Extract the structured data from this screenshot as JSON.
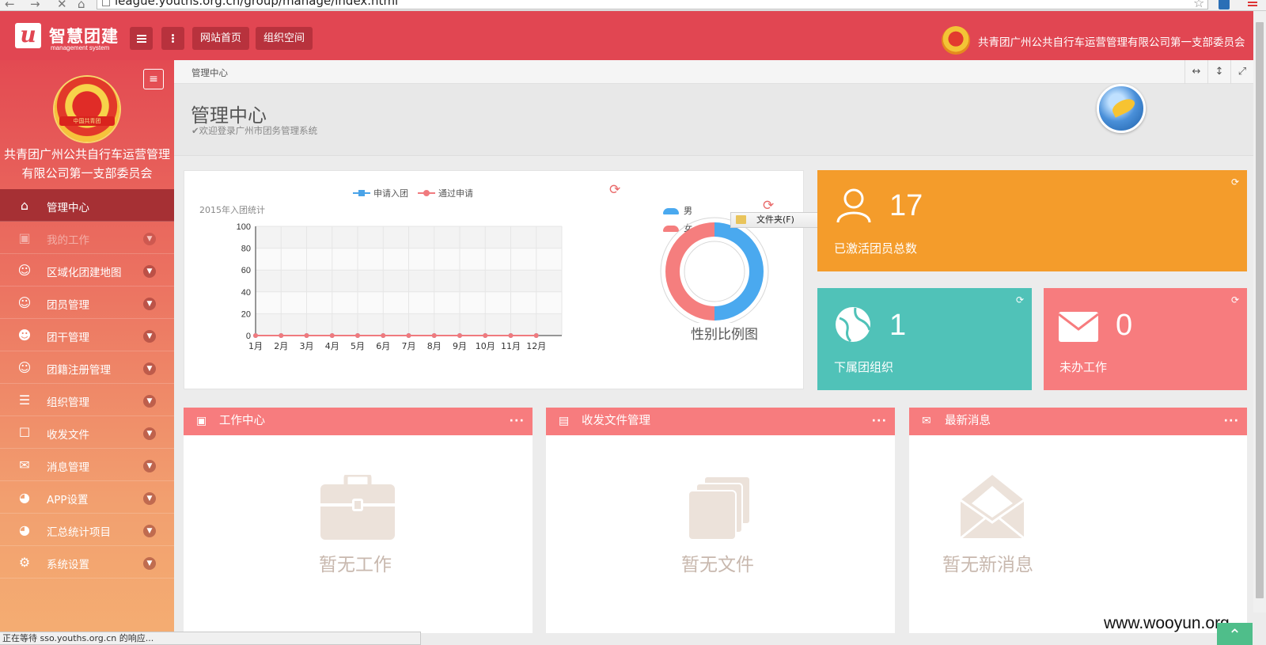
{
  "browser": {
    "url": "league.youths.org.cn/group/manage/index.html",
    "status_text": "正在等待 sso.youths.org.cn 的响应..."
  },
  "header": {
    "logo_letter": "u",
    "logo_title": "智慧团建",
    "logo_subtitle": "management system",
    "nav_home": "网站首页",
    "nav_space": "组织空间",
    "org_name": "共青团广州公共自行车运营管理有限公司第一支部委员会"
  },
  "sidebar": {
    "emblem_ribbon": "中国共青团",
    "org_name": "共青团广州公共自行车运营管理有限公司第一支部委员会",
    "items": [
      {
        "label": "管理中心",
        "icon": "home-icon"
      },
      {
        "label": "我的工作",
        "icon": "briefcase-icon"
      },
      {
        "label": "区域化团建地图",
        "icon": "user-icon"
      },
      {
        "label": "团员管理",
        "icon": "user-icon"
      },
      {
        "label": "团干管理",
        "icon": "users-icon"
      },
      {
        "label": "团籍注册管理",
        "icon": "user-icon"
      },
      {
        "label": "组织管理",
        "icon": "layers-icon"
      },
      {
        "label": "收发文件",
        "icon": "file-icon"
      },
      {
        "label": "消息管理",
        "icon": "mail-icon"
      },
      {
        "label": "APP设置",
        "icon": "gauge-icon"
      },
      {
        "label": "汇总统计项目",
        "icon": "gauge-icon"
      },
      {
        "label": "系统设置",
        "icon": "gear-icon"
      }
    ]
  },
  "breadcrumb": {
    "current": "管理中心"
  },
  "page": {
    "title": "管理中心",
    "subtitle": "欢迎登录广州市团务管理系统"
  },
  "context_menu": {
    "item": "文件夹(F)"
  },
  "chart_data": [
    {
      "type": "line",
      "title": "2015年入团统计",
      "categories": [
        "1月",
        "2月",
        "3月",
        "4月",
        "5月",
        "6月",
        "7月",
        "8月",
        "9月",
        "10月",
        "11月",
        "12月"
      ],
      "series": [
        {
          "name": "申请入团",
          "values": [
            0,
            0,
            0,
            0,
            0,
            0,
            0,
            0,
            0,
            0,
            0,
            0
          ],
          "color": "#4aa3e8"
        },
        {
          "name": "通过申请",
          "values": [
            0,
            0,
            0,
            0,
            0,
            0,
            0,
            0,
            0,
            0,
            0,
            0
          ],
          "color": "#f07a7e"
        }
      ],
      "yticks": [
        "0",
        "20",
        "40",
        "60",
        "80",
        "100"
      ],
      "ylim": [
        0,
        100
      ],
      "grid": true,
      "legend": "top"
    },
    {
      "type": "pie",
      "title": "性别比例图",
      "labels": [
        "男",
        "女"
      ],
      "values": [
        50,
        50
      ],
      "colors": [
        "#4aa9ef",
        "#f57e7e"
      ],
      "legend": "top-left"
    }
  ],
  "stats": {
    "activated": {
      "value": "17",
      "label": "已激活团员总数",
      "color": "#f49c2b"
    },
    "sub_orgs": {
      "value": "1",
      "label": "下属团组织",
      "color": "#50c2b8"
    },
    "pending": {
      "value": "0",
      "label": "未办工作",
      "color": "#f77c7e"
    }
  },
  "panels": {
    "work": {
      "title": "工作中心",
      "empty": "暂无工作"
    },
    "files": {
      "title": "收发文件管理",
      "empty": "暂无文件"
    },
    "news": {
      "title": "最新消息",
      "empty": "暂无新消息"
    }
  },
  "watermark": "www.wooyun.org"
}
